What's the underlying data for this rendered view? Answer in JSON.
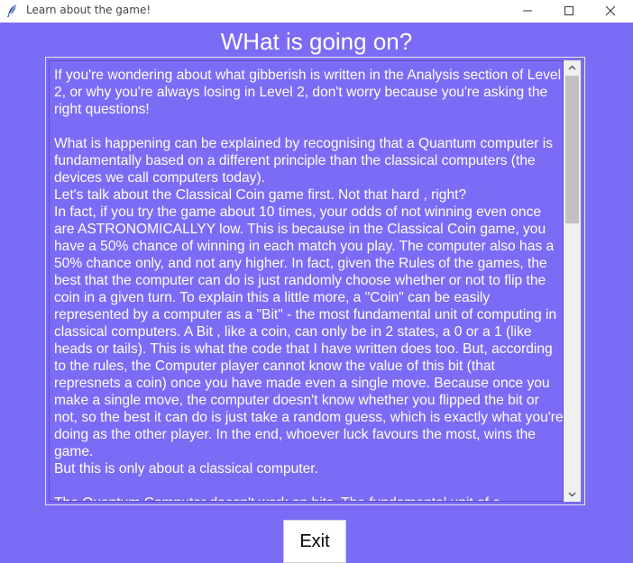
{
  "window": {
    "title": "Learn about the game!",
    "icon": "feather-icon",
    "controls": [
      "minimize-icon",
      "maximize-icon",
      "close-icon"
    ]
  },
  "heading": "WHat is going on?",
  "body_text": "If you're wondering about what gibberish is written in the Analysis section of Level 2, or why you're always losing in Level 2, don't worry because you're asking the right questions!\n\nWhat is happening can be explained by recognising that a Quantum computer is fundamentally based on a different principle than the classical computers (the devices we call computers today).\nLet's talk about the Classical Coin game first. Not that hard , right?\nIn fact, if you try the game about 10 times, your odds of not winning even once are ASTRONOMICALLYY low. This is because in the Classical Coin game, you have a 50% chance of winning in each match you play. The computer also has a 50% chance only, and not any higher. In fact, given the Rules of the games, the best that the computer can do is just randomly choose whether or not to flip the coin in a given turn. To explain this a little more, a \"Coin\" can be easily represented by a computer as a \"Bit\" - the most fundamental unit of computing in classical computers. A Bit , like a coin, can only be in 2 states, a 0 or a 1 (like heads or tails). This is what the code that I have written does too. But, according to the rules, the Computer player cannot know the value of this bit (that represnets a coin) once you have made even a single move. Because once you make a single move, the computer doesn't know whether you flipped the bit or not, so the best it can do is just take a random guess, which is exactly what you're doing as the other player. In the end, whoever luck favours the most, wins the game.\nBut this is only about a classical computer.\n\nThe Quantum Computer doesn't work on bits. The fundamental unit of a",
  "exit_label": "Exit",
  "colors": {
    "background": "#7b6cf6",
    "text": "#ffffff"
  }
}
